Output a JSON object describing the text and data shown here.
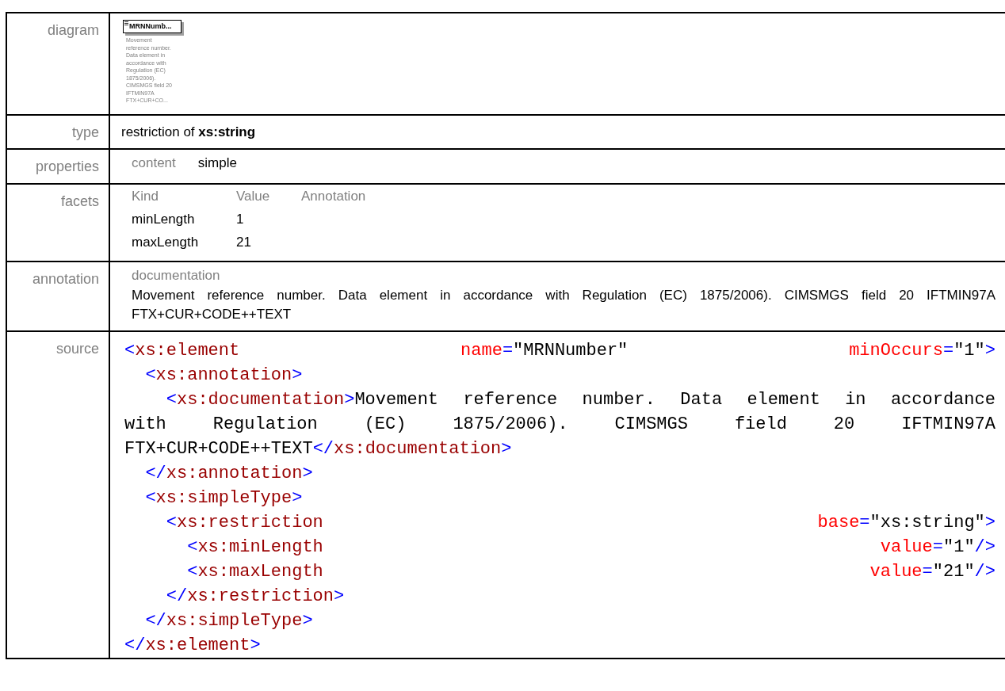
{
  "rows": [
    {
      "kind": "diagram",
      "label": "diagram",
      "node": {
        "name": "MRNNumb...",
        "doc": "Movement reference number. Data element in accordance with Regulation (EC) 1875/2006). CIMSMGS field 20 IFTMIN97A FTX+CUR+CO..."
      }
    },
    {
      "kind": "type",
      "label": "type",
      "prefix": "restriction of",
      "base": "xs:string"
    },
    {
      "kind": "properties",
      "label": "properties",
      "items": [
        {
          "name": "content",
          "value": "simple"
        }
      ]
    },
    {
      "kind": "facets",
      "label": "facets",
      "columns": [
        "Kind",
        "Value",
        "Annotation"
      ],
      "items": [
        {
          "kind": "minLength",
          "value": "1"
        },
        {
          "kind": "maxLength",
          "value": "21"
        }
      ]
    },
    {
      "kind": "annotation",
      "label": "annotation",
      "title": "documentation",
      "text": "Movement reference number. Data element in accordance with Regulation (EC) 1875/2006). CIMSMGS field 20 IFTMIN97A FTX+CUR+CODE++TEXT"
    },
    {
      "kind": "source",
      "label": "source",
      "lines": [
        {
          "spread": true,
          "words": [
            [
              {
                "kind": "punct",
                "text": "<"
              },
              {
                "kind": "tag",
                "text": "xs:element"
              }
            ],
            [
              {
                "kind": "attr",
                "text": "name"
              },
              {
                "kind": "punct",
                "text": "="
              },
              {
                "kind": "text",
                "text": "\"MRNNumber\""
              }
            ],
            [
              {
                "kind": "attr",
                "text": "minOccurs"
              },
              {
                "kind": "punct",
                "text": "="
              },
              {
                "kind": "text",
                "text": "\"1\""
              },
              {
                "kind": "punct",
                "text": ">"
              }
            ]
          ],
          "children": [
            {
              "words": [
                [
                  {
                    "kind": "punct",
                    "text": "<"
                  },
                  {
                    "kind": "tag",
                    "text": "xs:annotation"
                  },
                  {
                    "kind": "punct",
                    "text": ">"
                  }
                ]
              ],
              "children": [
                {
                  "spread": true,
                  "words": [
                    [
                      {
                        "kind": "punct",
                        "text": "<"
                      },
                      {
                        "kind": "tag",
                        "text": "xs:documentation"
                      },
                      {
                        "kind": "punct",
                        "text": ">"
                      },
                      {
                        "kind": "text",
                        "text": "Movement"
                      }
                    ],
                    [
                      {
                        "kind": "text",
                        "text": "reference"
                      }
                    ],
                    [
                      {
                        "kind": "text",
                        "text": "number."
                      }
                    ],
                    [
                      {
                        "kind": "text",
                        "text": "Data"
                      }
                    ],
                    [
                      {
                        "kind": "text",
                        "text": "element"
                      }
                    ],
                    [
                      {
                        "kind": "text",
                        "text": "in"
                      }
                    ],
                    [
                      {
                        "kind": "text",
                        "text": "accordance"
                      }
                    ]
                  ],
                  "continuation": [
                    {
                      "spread": true,
                      "words": [
                        [
                          {
                            "kind": "text",
                            "text": "with"
                          }
                        ],
                        [
                          {
                            "kind": "text",
                            "text": "Regulation"
                          }
                        ],
                        [
                          {
                            "kind": "text",
                            "text": "(EC)"
                          }
                        ],
                        [
                          {
                            "kind": "text",
                            "text": "1875/2006)."
                          }
                        ],
                        [
                          {
                            "kind": "text",
                            "text": "CIMSMGS"
                          }
                        ],
                        [
                          {
                            "kind": "text",
                            "text": "field"
                          }
                        ],
                        [
                          {
                            "kind": "text",
                            "text": "20"
                          }
                        ],
                        [
                          {
                            "kind": "text",
                            "text": "IFTMIN97A"
                          }
                        ]
                      ]
                    },
                    {
                      "words": [
                        [
                          {
                            "kind": "text",
                            "text": "FTX+CUR+CODE++TEXT"
                          },
                          {
                            "kind": "punct",
                            "text": "</"
                          },
                          {
                            "kind": "tag",
                            "text": "xs:documentation"
                          },
                          {
                            "kind": "punct",
                            "text": ">"
                          }
                        ]
                      ]
                    }
                  ]
                }
              ]
            },
            {
              "words": [
                [
                  {
                    "kind": "punct",
                    "text": "</"
                  },
                  {
                    "kind": "tag",
                    "text": "xs:annotation"
                  },
                  {
                    "kind": "punct",
                    "text": ">"
                  }
                ]
              ]
            },
            {
              "words": [
                [
                  {
                    "kind": "punct",
                    "text": "<"
                  },
                  {
                    "kind": "tag",
                    "text": "xs:simpleType"
                  },
                  {
                    "kind": "punct",
                    "text": ">"
                  }
                ]
              ],
              "children": [
                {
                  "spread": true,
                  "words": [
                    [
                      {
                        "kind": "punct",
                        "text": "<"
                      },
                      {
                        "kind": "tag",
                        "text": "xs:restriction"
                      }
                    ],
                    [
                      {
                        "kind": "attr",
                        "text": "base"
                      },
                      {
                        "kind": "punct",
                        "text": "="
                      },
                      {
                        "kind": "text",
                        "text": "\"xs:string\""
                      },
                      {
                        "kind": "punct",
                        "text": ">"
                      }
                    ]
                  ],
                  "children": [
                    {
                      "spread": true,
                      "words": [
                        [
                          {
                            "kind": "punct",
                            "text": "<"
                          },
                          {
                            "kind": "tag",
                            "text": "xs:minLength"
                          }
                        ],
                        [
                          {
                            "kind": "attr",
                            "text": "value"
                          },
                          {
                            "kind": "punct",
                            "text": "="
                          },
                          {
                            "kind": "text",
                            "text": "\"1\""
                          },
                          {
                            "kind": "punct",
                            "text": "/>"
                          }
                        ]
                      ]
                    },
                    {
                      "spread": true,
                      "words": [
                        [
                          {
                            "kind": "punct",
                            "text": "<"
                          },
                          {
                            "kind": "tag",
                            "text": "xs:maxLength"
                          }
                        ],
                        [
                          {
                            "kind": "attr",
                            "text": "value"
                          },
                          {
                            "kind": "punct",
                            "text": "="
                          },
                          {
                            "kind": "text",
                            "text": "\"21\""
                          },
                          {
                            "kind": "punct",
                            "text": "/>"
                          }
                        ]
                      ]
                    }
                  ]
                },
                {
                  "words": [
                    [
                      {
                        "kind": "punct",
                        "text": "</"
                      },
                      {
                        "kind": "tag",
                        "text": "xs:restriction"
                      },
                      {
                        "kind": "punct",
                        "text": ">"
                      }
                    ]
                  ]
                }
              ]
            },
            {
              "words": [
                [
                  {
                    "kind": "punct",
                    "text": "</"
                  },
                  {
                    "kind": "tag",
                    "text": "xs:simpleType"
                  },
                  {
                    "kind": "punct",
                    "text": ">"
                  }
                ]
              ]
            }
          ]
        },
        {
          "words": [
            [
              {
                "kind": "punct",
                "text": "</"
              },
              {
                "kind": "tag",
                "text": "xs:element"
              },
              {
                "kind": "punct",
                "text": ">"
              }
            ]
          ]
        }
      ]
    }
  ]
}
